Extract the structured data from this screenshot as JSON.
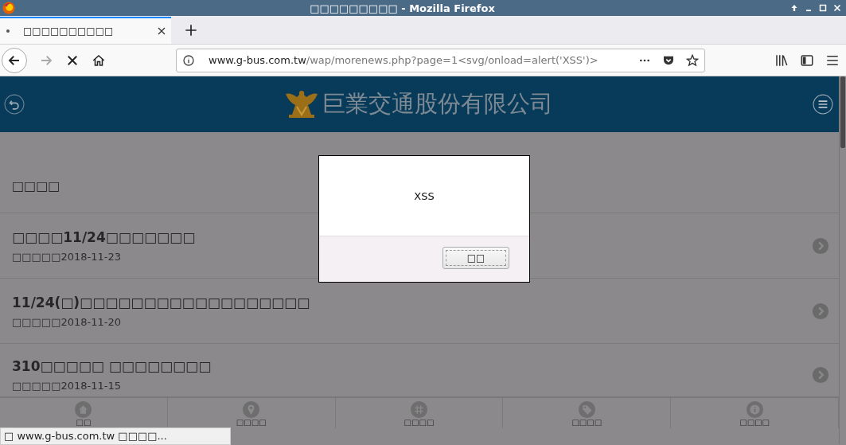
{
  "window": {
    "title": "□□□□□□□□□ - Mozilla Firefox"
  },
  "tabs": [
    {
      "title": "□□□□□□□□□□",
      "selected": true
    }
  ],
  "address_bar": {
    "host": "www.g-bus.com.tw",
    "path": "/wap/morenews.php?page=1<svg/onload=alert('XSS')>"
  },
  "page": {
    "site_title": "巨業交通股份有限公司",
    "section_title": "□□□□",
    "news": [
      {
        "title": "□□□□11/24□□□□□□□",
        "date": "□□□□□2018-11-23"
      },
      {
        "title": "11/24(□)□□□□□□□□□□□□□□□□□□",
        "date": "□□□□□2018-11-20"
      },
      {
        "title": "310□□□□□ □□□□□□□□",
        "date": "□□□□□2018-11-15"
      }
    ],
    "bottom_nav": [
      {
        "kind": "home",
        "label": "□□"
      },
      {
        "kind": "pin",
        "label": "□□□□"
      },
      {
        "kind": "grid",
        "label": "□□□□"
      },
      {
        "kind": "tag",
        "label": "□□□□"
      },
      {
        "kind": "info",
        "label": "□□□□"
      }
    ]
  },
  "alert": {
    "message": "XSS",
    "button": "□□"
  },
  "status_bar": "□ www.g-bus.com.tw □□□□..."
}
